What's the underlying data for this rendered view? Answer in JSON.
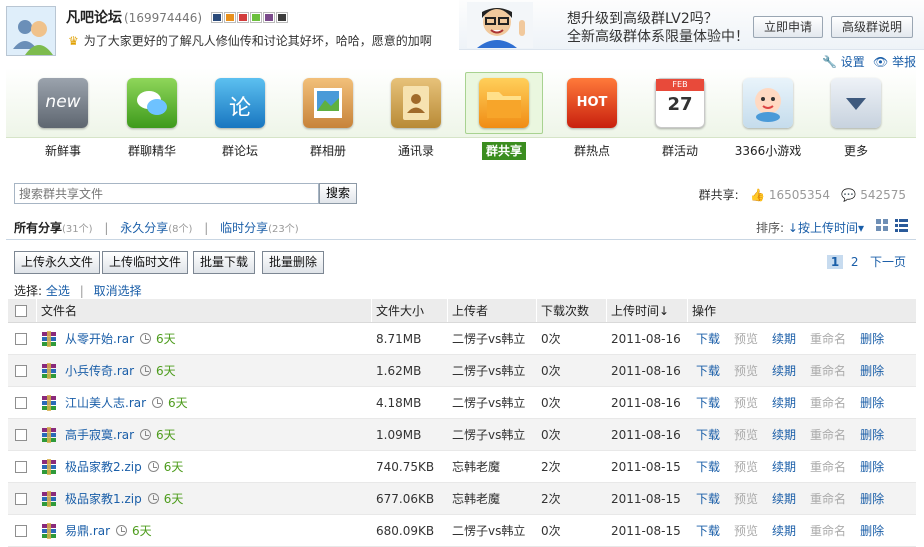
{
  "group": {
    "name": "凡吧论坛",
    "id": "(169974446)",
    "description": "为了大家更好的了解凡人修仙传和讨论其好坏，哈哈，愿意的加啊"
  },
  "promo": {
    "line1": "想升级到高级群LV2吗？",
    "line2": "全新高级群体系限量体验中！",
    "apply_btn": "立即申请",
    "help_btn": "高级群说明"
  },
  "top_links": {
    "settings": "设置",
    "report": "举报"
  },
  "toolbar": {
    "items": [
      {
        "label": "新鲜事",
        "icon": "new-icon"
      },
      {
        "label": "群聊精华",
        "icon": "chat-icon"
      },
      {
        "label": "群论坛",
        "icon": "forum-icon"
      },
      {
        "label": "群相册",
        "icon": "album-icon"
      },
      {
        "label": "通讯录",
        "icon": "contacts-icon"
      },
      {
        "label": "群共享",
        "icon": "folder-icon"
      },
      {
        "label": "群热点",
        "icon": "hot-icon"
      },
      {
        "label": "群活动",
        "icon": "calendar-icon"
      },
      {
        "label": "3366小游戏",
        "icon": "game-icon"
      },
      {
        "label": "更多",
        "icon": "more-icon"
      }
    ],
    "calendar_month": "FEB",
    "calendar_day": "27",
    "hot_text": "HOT",
    "new_text": "new",
    "forum_text": "论"
  },
  "search": {
    "placeholder": "搜索群共享文件",
    "button": "搜索"
  },
  "stats": {
    "label": "群共享:",
    "likes": "16505354",
    "comments": "542575"
  },
  "tabs": {
    "all": "所有分享",
    "all_count": "(31个)",
    "perm": "永久分享",
    "perm_count": "(8个)",
    "temp": "临时分享",
    "temp_count": "(23个)"
  },
  "sort": {
    "label": "排序:",
    "value": "↓按上传时间▾"
  },
  "actions": {
    "upload_perm": "上传永久文件",
    "upload_temp": "上传临时文件",
    "batch_download": "批量下载",
    "batch_delete": "批量删除"
  },
  "pager": {
    "current": "1",
    "next_page": "2",
    "next": "下一页"
  },
  "select": {
    "label": "选择:",
    "all": "全选",
    "none": "取消选择"
  },
  "table": {
    "headers": [
      "文件名",
      "文件大小",
      "上传者",
      "下载次数",
      "上传时间↓",
      "操作"
    ],
    "ops": [
      "下载",
      "预览",
      "续期",
      "重命名",
      "删除"
    ],
    "rows": [
      {
        "name": "从零开始.rar",
        "days": "6天",
        "size": "8.71MB",
        "uploader": "二愣子vs韩立",
        "downloads": "0次",
        "date": "2011-08-16"
      },
      {
        "name": "小兵传奇.rar",
        "days": "6天",
        "size": "1.62MB",
        "uploader": "二愣子vs韩立",
        "downloads": "0次",
        "date": "2011-08-16"
      },
      {
        "name": "江山美人志.rar",
        "days": "6天",
        "size": "4.18MB",
        "uploader": "二愣子vs韩立",
        "downloads": "0次",
        "date": "2011-08-16"
      },
      {
        "name": "高手寂寞.rar",
        "days": "6天",
        "size": "1.09MB",
        "uploader": "二愣子vs韩立",
        "downloads": "0次",
        "date": "2011-08-16"
      },
      {
        "name": "极品家教2.zip",
        "days": "6天",
        "size": "740.75KB",
        "uploader": "忘韩老魔",
        "downloads": "2次",
        "date": "2011-08-15"
      },
      {
        "name": "极品家教1.zip",
        "days": "6天",
        "size": "677.06KB",
        "uploader": "忘韩老魔",
        "downloads": "2次",
        "date": "2011-08-15"
      },
      {
        "name": "易鼎.rar",
        "days": "6天",
        "size": "680.09KB",
        "uploader": "二愣子vs韩立",
        "downloads": "0次",
        "date": "2011-08-15"
      }
    ]
  }
}
